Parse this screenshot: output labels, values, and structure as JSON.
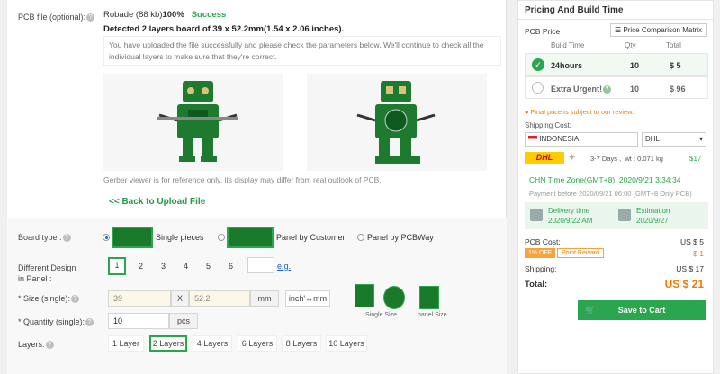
{
  "upload": {
    "label": "PCB file (optional):",
    "filename": "Robade (88 kb)",
    "percent": "100%",
    "status": "Success",
    "detected": "Detected 2 layers board of 39 x 52.2mm(1.54 x 2.06 inches).",
    "note": "You have uploaded the file successfully and please check the parameters below. We'll continue to check all the individual layers to make sure that they're correct.",
    "gerber_note": "Gerber viewer is for reference only, its display may differ from real outlook of PCB.",
    "back_link": "<< Back to Upload File"
  },
  "board_type": {
    "label": "Board type :",
    "options": [
      "Single pieces",
      "Panel by Customer",
      "Panel by PCBWay"
    ],
    "selected": "Single pieces"
  },
  "design": {
    "label_line1": "Different Design",
    "label_line2": "in Panel :",
    "options": [
      "1",
      "2",
      "3",
      "4",
      "5",
      "6"
    ],
    "selected": "1",
    "eg": "e.g."
  },
  "size": {
    "label": "* Size (single):",
    "x": "39",
    "sep": "X",
    "y": "52.2",
    "unit": "mm",
    "convert": "inch'↔mm",
    "single_caption": "Single Size",
    "panel_caption": "panel Size"
  },
  "quantity": {
    "label": "* Quantity (single):",
    "value": "10",
    "unit": "pcs"
  },
  "layers": {
    "label": "Layers:",
    "options": [
      "1 Layer",
      "2 Layers",
      "4 Layers",
      "6 Layers",
      "8 Layers",
      "10 Layers"
    ],
    "selected": "2 Layers"
  },
  "pricing": {
    "title": "Pricing And Build Time",
    "pcb_price": "PCB Price",
    "compare_button": "Price Comparison Matrix",
    "headers": [
      "Build Time",
      "Qty",
      "Total"
    ],
    "rows": [
      {
        "time": "24hours",
        "qty": "10",
        "total": "$ 5",
        "selected": true
      },
      {
        "time": "Extra Urgent!",
        "qty": "10",
        "total": "$ 96",
        "selected": false
      }
    ],
    "final_note": "Final price is subject to our review.",
    "shipping_label": "Shipping Cost:",
    "country": "INDONESIA",
    "carrier": "DHL",
    "carrier_logo": "DHL",
    "days": "3-7 Days ,",
    "weight": "wt : 0.071 kg",
    "ship_price": "$17",
    "chn_time": "CHN Time Zone(GMT+8): 2020/9/21 3:34:34",
    "payment_before": "Payment before 2020/09/21 06:00 (GMT+8 Only PCB)",
    "delivery_label": "Delivery time",
    "delivery_date": "2020/9/22 AM",
    "estimation_label": "Estimation",
    "estimation_date": "2020/9/27",
    "pcb_cost_label": "PCB Cost:",
    "pcb_cost": "US $ 5",
    "discount_badge": "1% OFF",
    "point_reward": "Point Reward",
    "discount_value": "-$ 1",
    "shipping_total_label": "Shipping:",
    "shipping_total": "US $ 17",
    "total_label": "Total:",
    "total": "US $ 21",
    "cart_button": "Save to Cart"
  },
  "colors": {
    "accent": "#2aa64f",
    "orange": "#f07c00",
    "pcb_green": "#1a7a2a"
  }
}
